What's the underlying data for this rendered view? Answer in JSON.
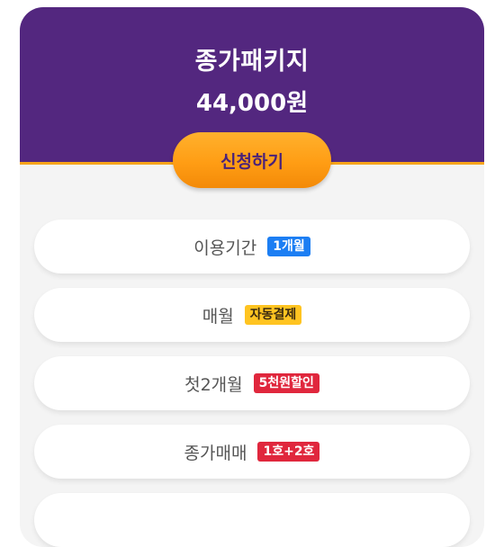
{
  "package": {
    "title": "종가패키지",
    "price": "44,000원",
    "cta_label": "신청하기"
  },
  "colors": {
    "header_bg": "#53277f",
    "cta_bg": "#ff9d14",
    "badge_blue": "#1c7ef3",
    "badge_yellow": "#ffc421",
    "badge_red": "#e0273d"
  },
  "rows": [
    {
      "label": "이용기간",
      "badge": "1개월",
      "badge_color": "blue"
    },
    {
      "label": "매월",
      "badge": "자동결제",
      "badge_color": "yellow"
    },
    {
      "label": "첫2개월",
      "badge": "5천원할인",
      "badge_color": "red"
    },
    {
      "label": "종가매매",
      "badge": "1호+2호",
      "badge_color": "red"
    }
  ]
}
